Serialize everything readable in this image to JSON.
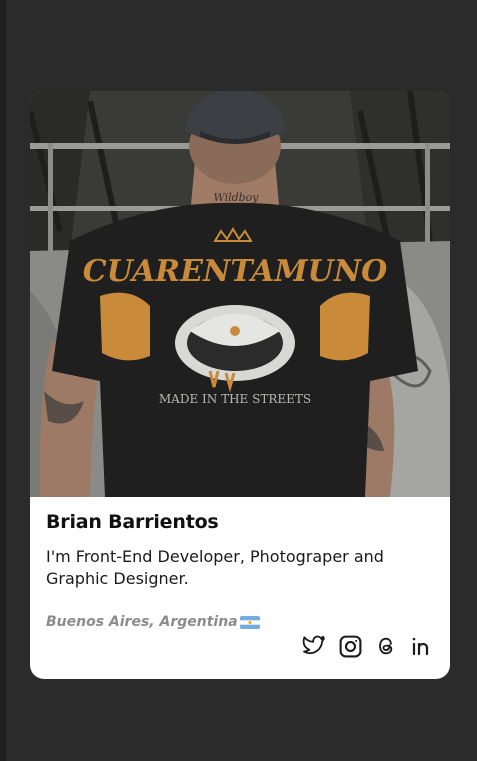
{
  "profile": {
    "name": "Brian Barrientos",
    "bio": "I'm Front-End Developer, Photograper and Graphic Designer.",
    "location": "Buenos Aires, Argentina",
    "photo_shirt_text": "CUARENTAMUNO",
    "photo_shirt_subtext": "MADE IN THE STREETS",
    "photo_neck_text": "Wildboy"
  },
  "socials": [
    {
      "name": "Twitter",
      "icon": "twitter-icon"
    },
    {
      "name": "Instagram",
      "icon": "instagram-icon"
    },
    {
      "name": "Threads",
      "icon": "threads-icon"
    },
    {
      "name": "LinkedIn",
      "icon": "linkedin-icon"
    }
  ],
  "colors": {
    "page_bg": "#2b2b2b",
    "card_bg": "#ffffff",
    "name": "#111111",
    "location": "#8c8c8c",
    "shirt_accent": "#c98b3a"
  }
}
